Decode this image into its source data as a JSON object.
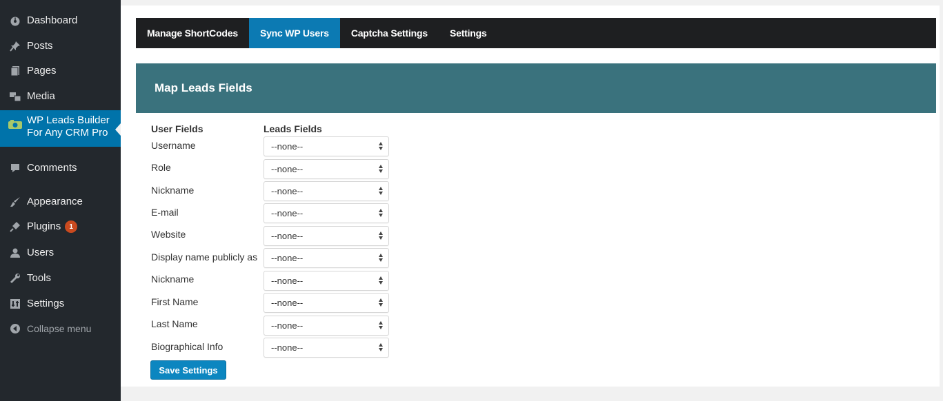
{
  "sidebar": {
    "items": [
      {
        "label": "Dashboard",
        "icon": "dashboard-icon"
      },
      {
        "label": "Posts",
        "icon": "pushpin-icon"
      },
      {
        "label": "Pages",
        "icon": "pages-icon"
      },
      {
        "label": "Media",
        "icon": "media-icon"
      },
      {
        "label": "WP Leads Builder For Any CRM Pro",
        "icon": "plugin-logo-icon",
        "active": true
      },
      {
        "label": "Comments",
        "icon": "comments-icon"
      },
      {
        "label": "Appearance",
        "icon": "paintbrush-icon"
      },
      {
        "label": "Plugins",
        "icon": "plug-icon",
        "badge": "1"
      },
      {
        "label": "Users",
        "icon": "users-icon"
      },
      {
        "label": "Tools",
        "icon": "wrench-icon"
      },
      {
        "label": "Settings",
        "icon": "settings-icon"
      },
      {
        "label": "Collapse menu",
        "icon": "collapse-icon"
      }
    ]
  },
  "tabs": [
    {
      "label": "Manage ShortCodes"
    },
    {
      "label": "Sync WP Users",
      "active": true
    },
    {
      "label": "Captcha Settings"
    },
    {
      "label": "Settings"
    }
  ],
  "panel": {
    "title": "Map Leads Fields",
    "user_fields_header": "User Fields",
    "leads_fields_header": "Leads Fields",
    "rows": [
      {
        "label": "Username",
        "value": "--none--"
      },
      {
        "label": "Role",
        "value": "--none--"
      },
      {
        "label": "Nickname",
        "value": "--none--"
      },
      {
        "label": "E-mail",
        "value": "--none--"
      },
      {
        "label": "Website",
        "value": "--none--"
      },
      {
        "label": "Display name publicly as",
        "value": "--none--"
      },
      {
        "label": "Nickname",
        "value": "--none--"
      },
      {
        "label": "First Name",
        "value": "--none--"
      },
      {
        "label": "Last Name",
        "value": "--none--"
      },
      {
        "label": "Biographical Info",
        "value": "--none--"
      }
    ],
    "save_label": "Save Settings"
  },
  "colors": {
    "sidebar_bg": "#23282d",
    "active_menu": "#0073aa",
    "panel_header": "#3a727d",
    "tab_bar": "#1e1f21",
    "active_tab": "#0c7ab3",
    "save_button": "#0c86c0",
    "badge": "#ca4a1f"
  }
}
